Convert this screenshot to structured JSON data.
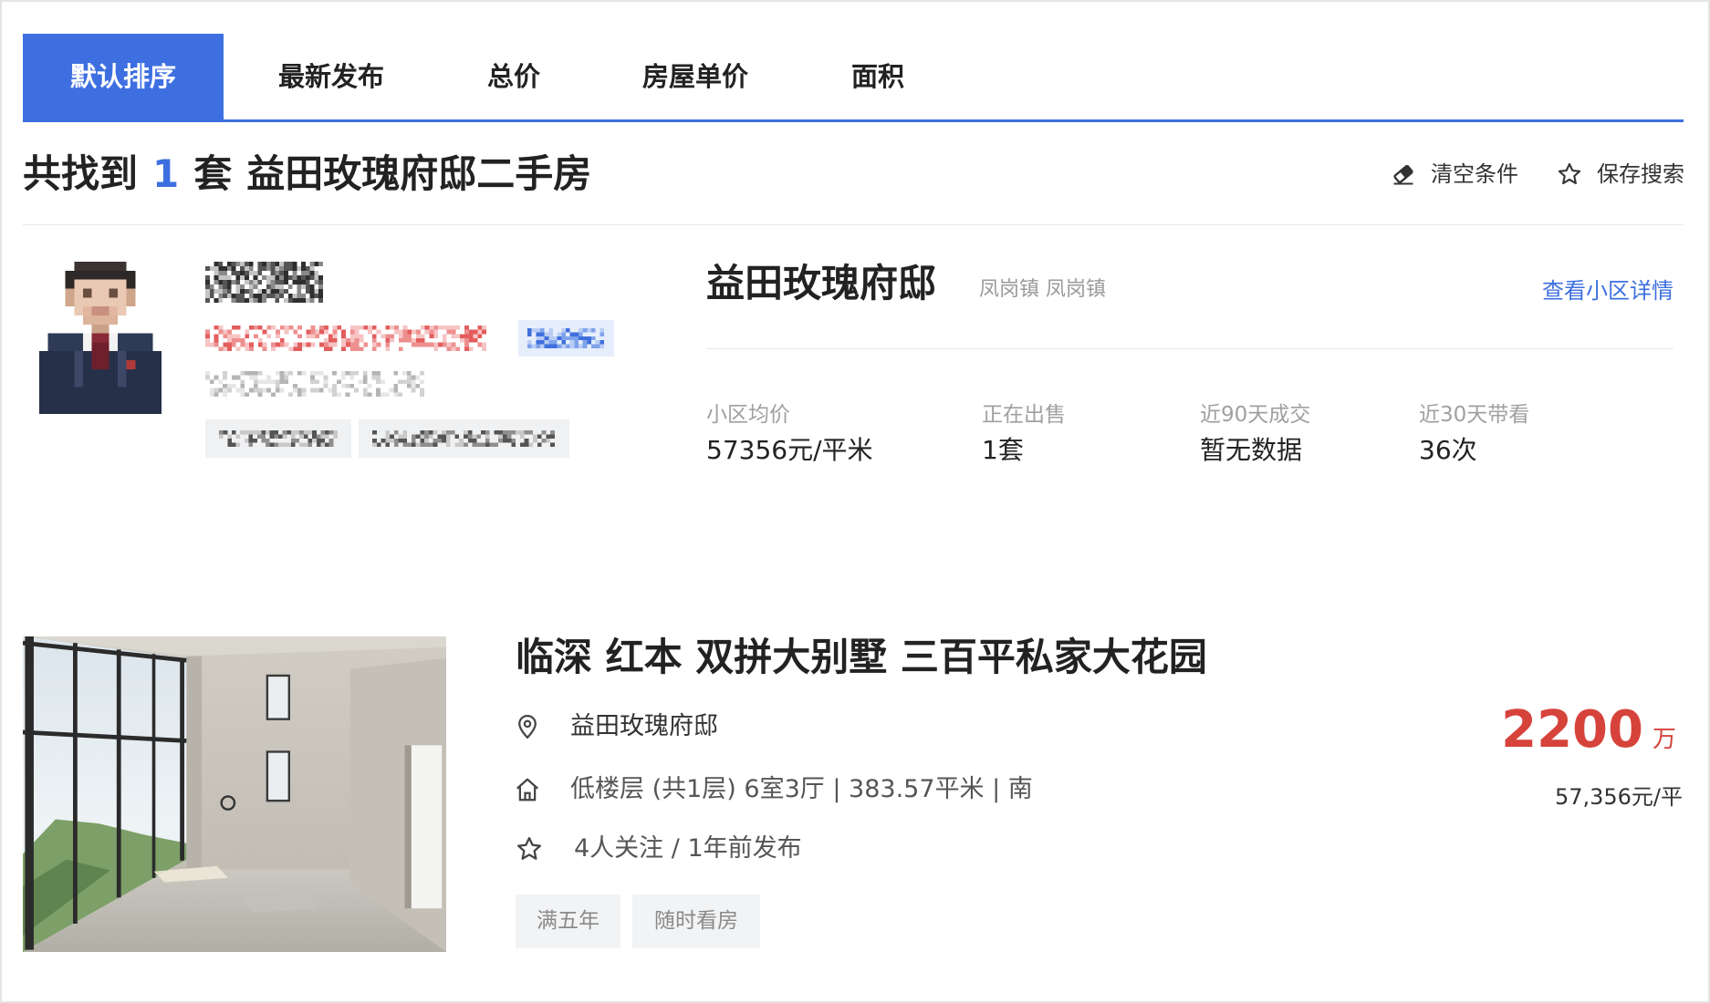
{
  "tabs": [
    {
      "label": "默认排序",
      "active": true
    },
    {
      "label": "最新发布",
      "active": false
    },
    {
      "label": "总价",
      "active": false
    },
    {
      "label": "房屋单价",
      "active": false
    },
    {
      "label": "面积",
      "active": false
    }
  ],
  "summary": {
    "prefix": "共找到",
    "count": "1",
    "unit": "套",
    "query": "益田玫瑰府邸二手房"
  },
  "actions": {
    "clear_label": "清空条件",
    "clear_icon": "eraser-icon",
    "save_label": "保存搜索",
    "save_icon": "star-icon"
  },
  "community": {
    "name": "益田玫瑰府邸",
    "location": "凤岗镇 凤岗镇",
    "detail_link": "查看小区详情",
    "stats": [
      {
        "label": "小区均价",
        "value": "57356元/平米"
      },
      {
        "label": "正在出售",
        "value": "1套"
      },
      {
        "label": "近90天成交",
        "value": "暂无数据"
      },
      {
        "label": "近30天带看",
        "value": "36次"
      }
    ]
  },
  "listing": {
    "title": "临深 红本 双拼大别墅 三百平私家大花园",
    "community": "益田玫瑰府邸",
    "house_info": "低楼层 (共1层) 6室3厅 | 383.57平米 | 南",
    "follow_info": "4人关注 / 1年前发布",
    "tags": [
      "满五年",
      "随时看房"
    ],
    "total_price": "2200",
    "total_price_unit": "万",
    "unit_price": "57,356元/平",
    "icons": {
      "community": "location-pin-icon",
      "house_info": "house-icon",
      "follow_info": "star-icon"
    }
  },
  "colors": {
    "accent": "#3d6fe0",
    "price": "#d6433b",
    "text": "#222222",
    "muted": "#9a9a9a",
    "tag_bg": "#f2f3f5"
  }
}
